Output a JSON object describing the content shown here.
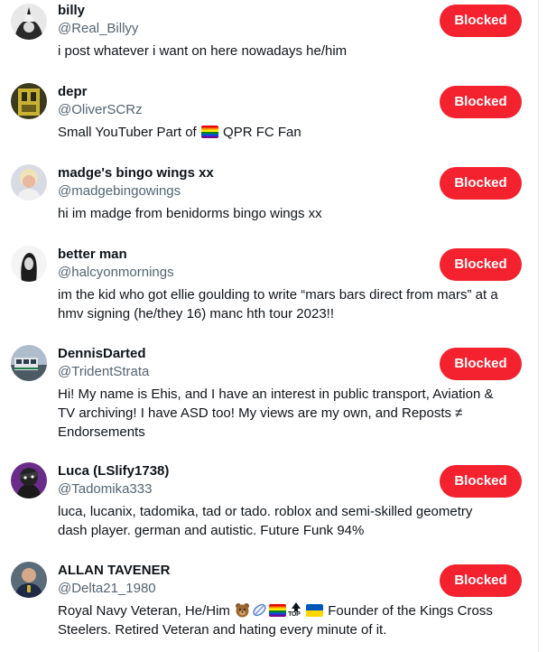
{
  "blocked_accounts": [
    {
      "name": "billy",
      "handle": "@Real_Billyy",
      "bio": "i post whatever i want on here nowadays he/him",
      "button_label": "Blocked"
    },
    {
      "name": "depr",
      "handle": "@OliverSCRz",
      "bio_parts": [
        "Small YouTuber Part of",
        "QPR FC Fan"
      ],
      "bio_emoji": [
        "rainbow-flag-icon"
      ],
      "button_label": "Blocked"
    },
    {
      "name": "madge's bingo wings xx",
      "handle": "@madgebingowings",
      "bio": "hi im madge from benidorms bingo wings xx",
      "button_label": "Blocked"
    },
    {
      "name": "better man",
      "handle": "@halcyonmornings",
      "bio_lines": [
        "im the kid who got ellie goulding to write “mars bars direct from mars” at a",
        "hmv signing (he/they 16) manc hth tour 2023!!"
      ],
      "button_label": "Blocked"
    },
    {
      "name": "DennisDarted",
      "handle": "@TridentStrata",
      "bio_lines": [
        "Hi! My name is Ehis, and I have an interest in public transport, Aviation &",
        "TV archiving! I have ASD too! My views are my own, and Reposts ≠",
        "Endorsements"
      ],
      "button_label": "Blocked"
    },
    {
      "name": "Luca (LSlify1738)",
      "handle": "@Tadomika333",
      "bio_lines": [
        "luca, lucanix, tadomika, tad or tado. roblox and semi-skilled geometry",
        "dash player. german and autistic. Future Funk 94%"
      ],
      "button_label": "Blocked"
    },
    {
      "name": "ALLAN TAVENER",
      "handle": "@Delta21_1980",
      "bio_parts": [
        "Royal Navy Veteran, He/Him",
        "Founder of the Kings Cross",
        "Steelers. Retired Veteran and hating every minute of it."
      ],
      "bio_emoji": [
        "bear-face-icon",
        "rugby-ball-icon",
        "rainbow-flag-icon",
        "top-arrow-icon",
        "ukraine-flag-icon"
      ],
      "bio_emoji_text": [
        "TOP"
      ],
      "button_label": "Blocked"
    }
  ],
  "colors": {
    "blocked_button": "#f4212e",
    "handle_text": "#536471",
    "primary_text": "#0f1419"
  }
}
